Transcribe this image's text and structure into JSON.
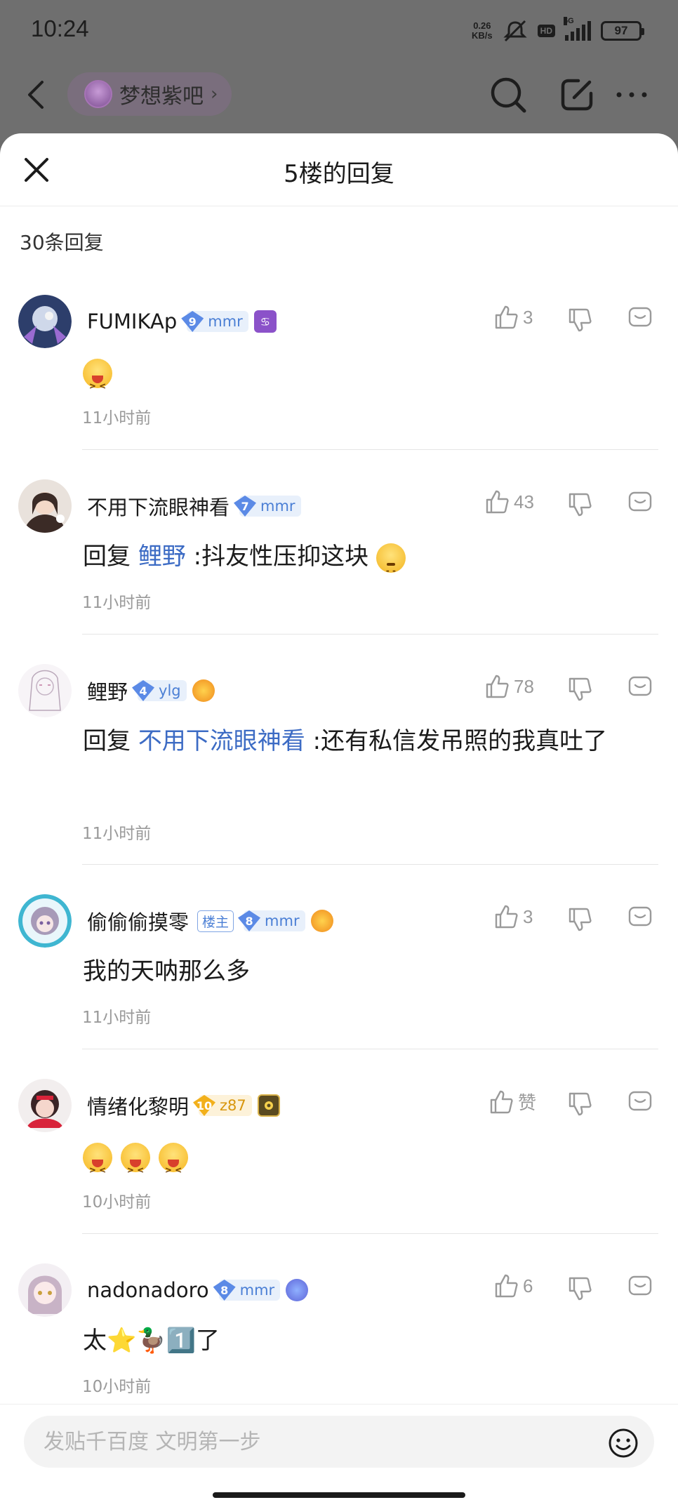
{
  "status_bar": {
    "time": "10:24",
    "net_speed": "0.26",
    "net_unit": "KB/s",
    "hd": "HD",
    "signal": "5G",
    "battery": "97"
  },
  "nav": {
    "forum_name": "梦想紫吧",
    "forum_arrow": "›"
  },
  "sheet": {
    "title": "5楼的回复",
    "reply_count": "30条回复"
  },
  "comments": [
    {
      "user": "FUMIKAp",
      "level": "9",
      "level_tag": "mmr",
      "likes": "3",
      "content_text": "",
      "emoji_count": 1,
      "time": "11小时前"
    },
    {
      "user": "不用下流眼神看",
      "level": "7",
      "level_tag": "mmr",
      "likes": "43",
      "reply_prefix": "回复 ",
      "mention": "鲤野",
      "content_text": " :抖友性压抑这块",
      "time": "11小时前"
    },
    {
      "user": "鲤野",
      "level": "4",
      "level_tag": "ylg",
      "likes": "78",
      "reply_prefix": "回复 ",
      "mention": "不用下流眼神看",
      "content_text": " :还有私信发吊照的我真吐了",
      "time": "11小时前"
    },
    {
      "user": "偷偷偷摸零",
      "owner_tag": "楼主",
      "level": "8",
      "level_tag": "mmr",
      "likes": "3",
      "content_text": "我的天呐那么多",
      "time": "11小时前"
    },
    {
      "user": "情绪化黎明",
      "level": "10",
      "level_tag": "z87",
      "likes": "赞",
      "content_text": "",
      "emoji_count": 3,
      "time": "10小时前"
    },
    {
      "user": "nadonadoro",
      "level": "8",
      "level_tag": "mmr",
      "likes": "6",
      "content_text": "太⭐🦆1️⃣了",
      "time": "10小时前"
    }
  ],
  "input": {
    "placeholder": "发贴千百度 文明第一步"
  },
  "colors": {
    "accent_blue": "#3c6bc4",
    "level_blue": "#5b8ae6",
    "level_gold": "#f2b01b",
    "sheet_bg": "#ffffff",
    "dim_bg": "#6f6f6f"
  }
}
